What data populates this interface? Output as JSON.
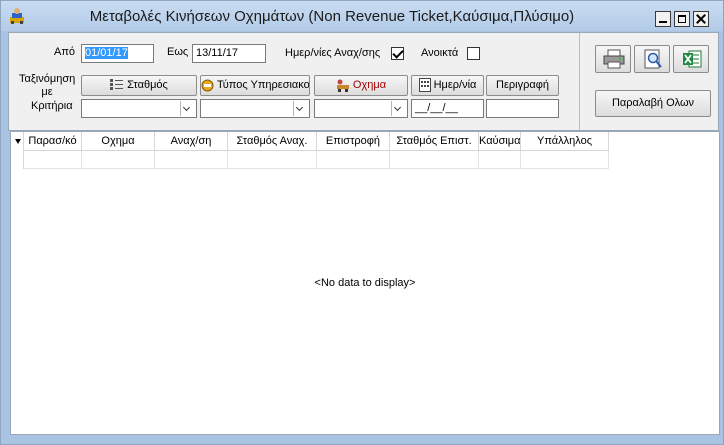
{
  "window": {
    "title": "Μεταβολές Κινήσεων Οχημάτων (Non Revenue Ticket,Καύσιμα,Πλύσιμο)"
  },
  "filters": {
    "from_label": "Από",
    "from_value": "01/01/17",
    "to_label": "Εως",
    "to_value": "13/11/17",
    "return_days_label": "Ημερ/νίες Αναχ/σης",
    "return_days_checked": true,
    "open_label": "Ανοικτά",
    "open_checked": false
  },
  "sorting": {
    "label": "Ταξινόμηση με",
    "criteria_label": "Κριτήρια",
    "buttons": [
      {
        "label": "Σταθμός",
        "icon": "station-icon"
      },
      {
        "label": "Τύπος Υπηρεσιακού",
        "icon": "service-type-icon"
      },
      {
        "label": "Οχημα",
        "icon": "vehicle-icon"
      },
      {
        "label": "Ημερ/νία",
        "icon": "calendar-icon"
      },
      {
        "label": "Περιγραφή",
        "icon": ""
      }
    ],
    "date_criteria_value": "__/__/__"
  },
  "actions": {
    "print_icon": "printer-icon",
    "preview_icon": "magnifier-icon",
    "excel_icon": "excel-icon",
    "receive_all_label": "Παραλαβή Ολων"
  },
  "grid": {
    "columns": [
      "Παρασ/κό",
      "Οχημα",
      "Αναχ/ση",
      "Σταθμός Αναχ.",
      "Επιστροφή",
      "Σταθμός Επιστ.",
      "Καύσιμα",
      "Υπάλληλος"
    ],
    "empty_text": "<No data to display>"
  }
}
